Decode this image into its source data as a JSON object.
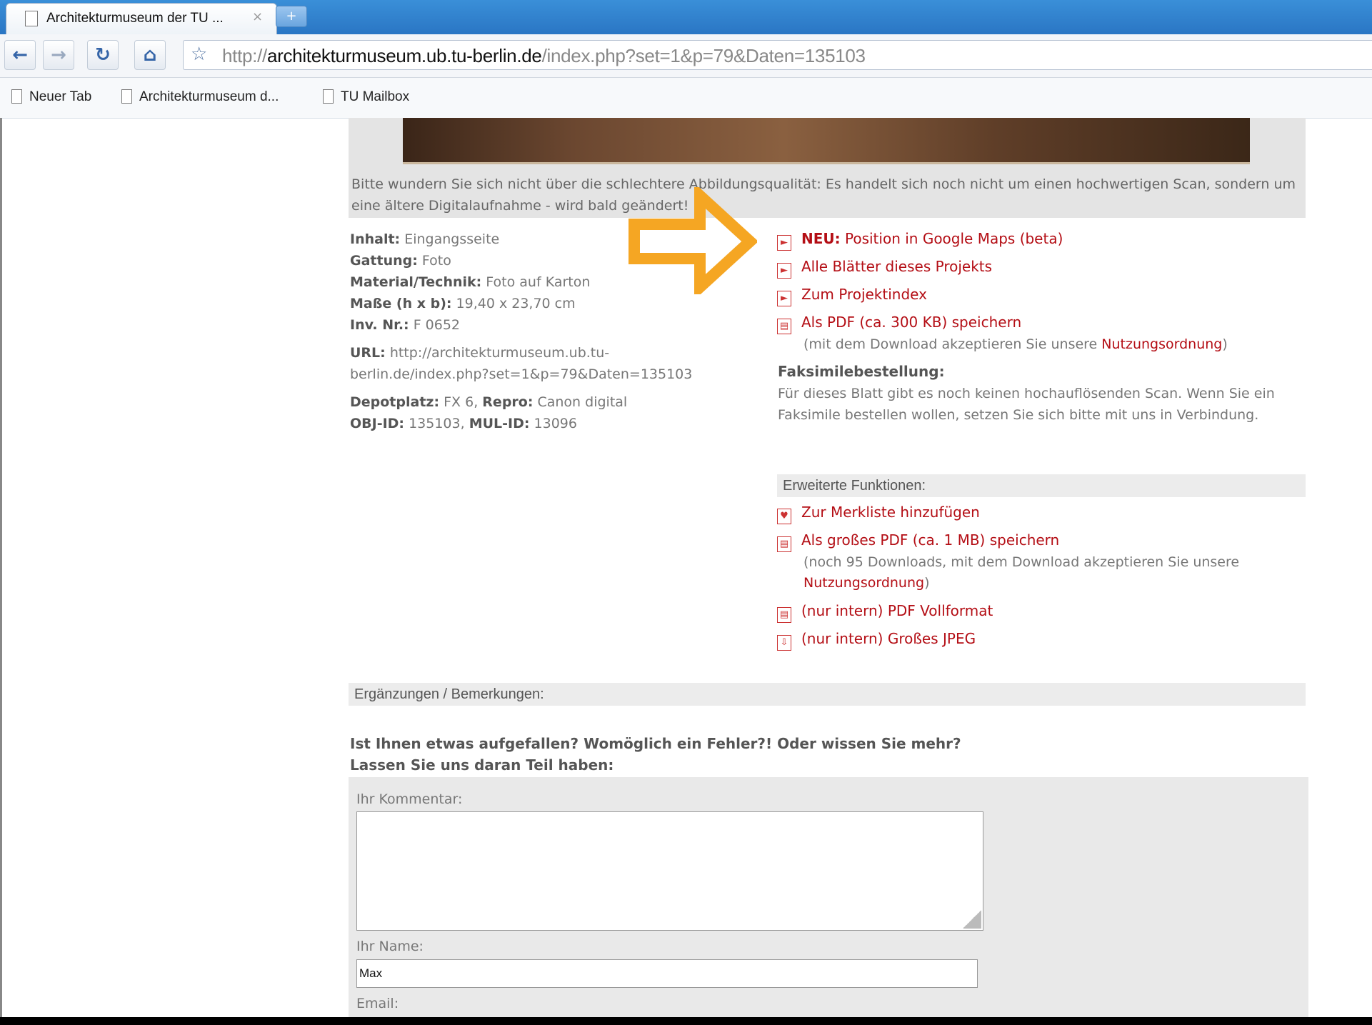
{
  "browser": {
    "tab_title": "Architekturmuseum der TU ...",
    "tab_close": "×",
    "newtab": "+",
    "url_scheme": "http://",
    "url_host": "architekturmuseum.ub.tu-berlin.de",
    "url_path": "/index.php?set=1&p=79&Daten=135103",
    "bookmarks": [
      "Neuer Tab",
      "Architekturmuseum d...",
      "TU Mailbox"
    ]
  },
  "notice": "Bitte wundern Sie sich nicht über die schlechtere Abbildungsqualität: Es handelt sich noch nicht um einen hochwertigen Scan, sondern um eine ältere Digitalaufnahme - wird bald geändert!",
  "info": {
    "inhalt_label": "Inhalt:",
    "inhalt": "Eingangsseite",
    "gattung_label": "Gattung:",
    "gattung": "Foto",
    "material_label": "Material/Technik:",
    "material": "Foto auf Karton",
    "masse_label": "Maße (h x b):",
    "masse": "19,40 x 23,70 cm",
    "inv_label": "Inv. Nr.:",
    "inv": "F 0652",
    "url_label": "URL:",
    "url_line1": "http://architekturmuseum.ub.tu-",
    "url_line2": "berlin.de/index.php?set=1&p=79&Daten=135103",
    "depot_label": "Depotplatz:",
    "depot": "FX 6,",
    "repro_label": "Repro:",
    "repro": "Canon digital",
    "obj_label": "OBJ-ID:",
    "obj": "135103,",
    "mul_label": "MUL-ID:",
    "mul": "13096"
  },
  "actions": {
    "maps_new": "NEU:",
    "maps": "Position in Google Maps (beta)",
    "sheets": "Alle Blätter dieses Projekts",
    "index": "Zum Projektindex",
    "pdf": "Als PDF (ca. 300 KB) speichern",
    "pdf_note_pre": "(mit dem Download akzeptieren Sie unsere ",
    "pdf_note_link": "Nutzungsordnung",
    "pdf_note_post": ")"
  },
  "faksimile": {
    "title": "Faksimilebestellung:",
    "text": "Für dieses Blatt gibt es noch keinen hochauflösenden Scan. Wenn Sie ein Faksimile bestellen wollen, setzen Sie sich bitte mit uns in Verbindung."
  },
  "extended": {
    "head": "Erweiterte Funktionen:",
    "merkliste": "Zur Merkliste hinzufügen",
    "big_pdf": "Als großes PDF (ca. 1 MB) speichern",
    "big_pdf_note1": "(noch 95 Downloads, mit dem Download akzeptieren Sie unsere",
    "big_pdf_note_link": "Nutzungsordnung",
    "big_pdf_note_post": ")",
    "pdf_full": "(nur intern) PDF Vollformat",
    "big_jpeg": "(nur intern) Großes JPEG"
  },
  "comments": {
    "head": "Ergänzungen / Bemerkungen:",
    "question1": "Ist Ihnen etwas aufgefallen? Womöglich ein Fehler?! Oder wissen Sie mehr?",
    "question2": "Lassen Sie uns daran Teil haben:",
    "comment_label": "Ihr Kommentar:",
    "comment_value": "",
    "name_label": "Ihr Name:",
    "name_value": "Max",
    "email_label": "Email:"
  },
  "colors": {
    "link_red": "#b40e15",
    "arrow_orange": "#f5a623",
    "chrome_blue": "#2a76c4"
  }
}
